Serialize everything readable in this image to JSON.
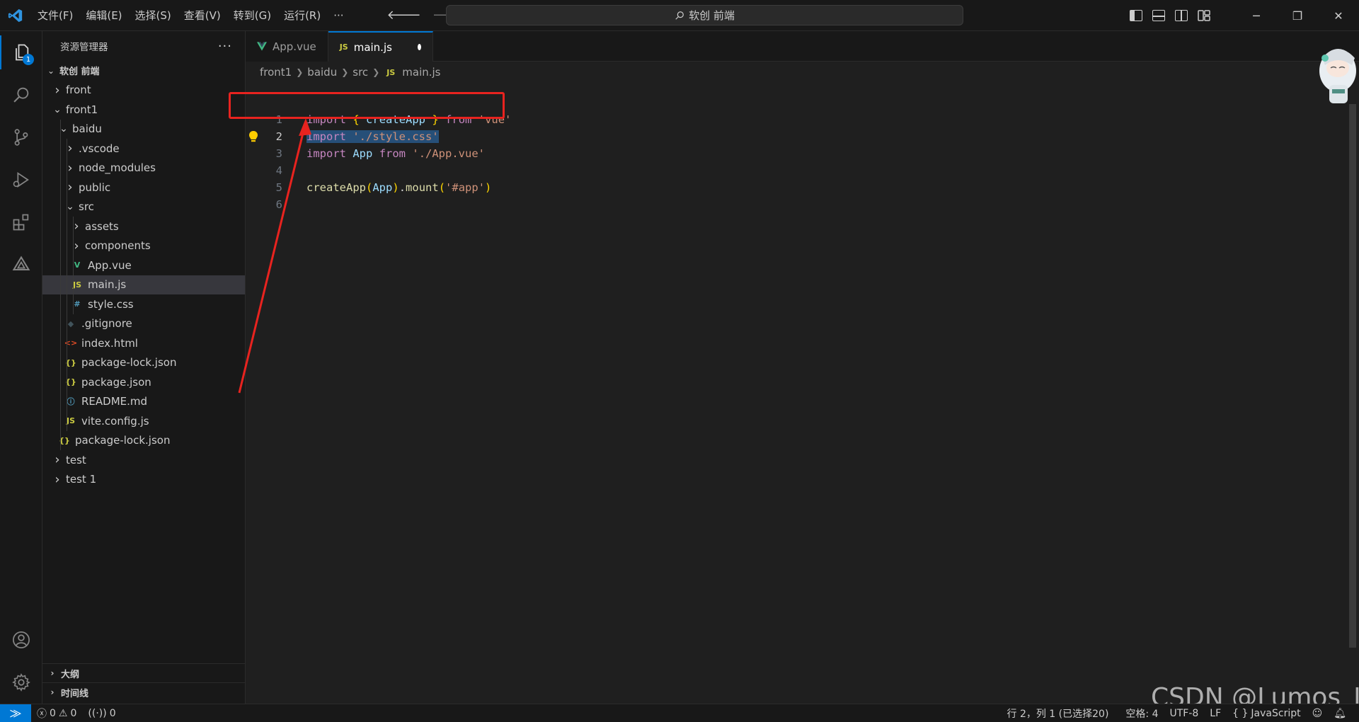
{
  "titlebar": {
    "menu": [
      "文件(F)",
      "编辑(E)",
      "选择(S)",
      "查看(V)",
      "转到(G)",
      "运行(R)",
      "···"
    ],
    "search_text": "软创 前端"
  },
  "activity": {
    "explorer_badge": "1"
  },
  "sidebar": {
    "title": "资源管理器",
    "more": "···",
    "root": "软创 前端",
    "tree": [
      {
        "label": "front",
        "depth": 1,
        "type": "folder",
        "open": false
      },
      {
        "label": "front1",
        "depth": 1,
        "type": "folder",
        "open": true
      },
      {
        "label": "baidu",
        "depth": 2,
        "type": "folder",
        "open": true
      },
      {
        "label": ".vscode",
        "depth": 3,
        "type": "folder",
        "open": false
      },
      {
        "label": "node_modules",
        "depth": 3,
        "type": "folder",
        "open": false
      },
      {
        "label": "public",
        "depth": 3,
        "type": "folder",
        "open": false
      },
      {
        "label": "src",
        "depth": 3,
        "type": "folder",
        "open": true
      },
      {
        "label": "assets",
        "depth": 4,
        "type": "folder",
        "open": false
      },
      {
        "label": "components",
        "depth": 4,
        "type": "folder",
        "open": false
      },
      {
        "label": "App.vue",
        "depth": 4,
        "type": "vue"
      },
      {
        "label": "main.js",
        "depth": 4,
        "type": "js",
        "selected": true
      },
      {
        "label": "style.css",
        "depth": 4,
        "type": "css"
      },
      {
        "label": ".gitignore",
        "depth": 3,
        "type": "git"
      },
      {
        "label": "index.html",
        "depth": 3,
        "type": "html"
      },
      {
        "label": "package-lock.json",
        "depth": 3,
        "type": "json"
      },
      {
        "label": "package.json",
        "depth": 3,
        "type": "json"
      },
      {
        "label": "README.md",
        "depth": 3,
        "type": "info"
      },
      {
        "label": "vite.config.js",
        "depth": 3,
        "type": "js"
      },
      {
        "label": "package-lock.json",
        "depth": 2,
        "type": "json"
      },
      {
        "label": "test",
        "depth": 1,
        "type": "folder",
        "open": false
      },
      {
        "label": "test 1",
        "depth": 1,
        "type": "folder",
        "open": false
      }
    ],
    "outline": "大纲",
    "timeline": "时间线"
  },
  "editor": {
    "tabs": [
      {
        "label": "App.vue",
        "icon": "vue"
      },
      {
        "label": "main.js",
        "icon": "JS",
        "active": true,
        "dirty": true
      }
    ],
    "breadcrumb": [
      "front1",
      "baidu",
      "src",
      "main.js"
    ],
    "breadcrumb_js": "JS",
    "lines": [
      {
        "n": "1",
        "tokens": [
          [
            "k",
            "import"
          ],
          [
            "p",
            " "
          ],
          [
            "b1",
            "{"
          ],
          [
            "p",
            " "
          ],
          [
            "v",
            "createApp"
          ],
          [
            "p",
            " "
          ],
          [
            "b1",
            "}"
          ],
          [
            "p",
            " "
          ],
          [
            "k",
            "from"
          ],
          [
            "p",
            " "
          ],
          [
            "s",
            "'vue'"
          ]
        ]
      },
      {
        "n": "2",
        "tokens": [
          [
            "k",
            "import"
          ],
          [
            "p",
            " "
          ],
          [
            "s",
            "'./style.css'"
          ]
        ],
        "selected": true,
        "current": true
      },
      {
        "n": "3",
        "tokens": [
          [
            "k",
            "import"
          ],
          [
            "p",
            " "
          ],
          [
            "v",
            "App"
          ],
          [
            "p",
            " "
          ],
          [
            "k",
            "from"
          ],
          [
            "p",
            " "
          ],
          [
            "s",
            "'./App.vue'"
          ]
        ]
      },
      {
        "n": "4",
        "tokens": []
      },
      {
        "n": "5",
        "tokens": [
          [
            "f",
            "createApp"
          ],
          [
            "b1",
            "("
          ],
          [
            "v",
            "App"
          ],
          [
            "b1",
            ")"
          ],
          [
            "p",
            "."
          ],
          [
            "f",
            "mount"
          ],
          [
            "b1",
            "("
          ],
          [
            "s",
            "'#app'"
          ],
          [
            "b1",
            ")"
          ]
        ]
      },
      {
        "n": "6",
        "tokens": []
      }
    ]
  },
  "status": {
    "errors": "0",
    "warnings": "0",
    "ports": "0",
    "position": "行 2，列 1 (已选择20)",
    "spaces": "空格: 4",
    "encoding": "UTF-8",
    "eol": "LF",
    "language_braces": "{ }",
    "language": "JavaScript"
  },
  "watermark": "CSDN @Lumos_II",
  "colors": {
    "accent": "#0078d4",
    "annotation": "#e8231f",
    "selection": "#264f78"
  }
}
